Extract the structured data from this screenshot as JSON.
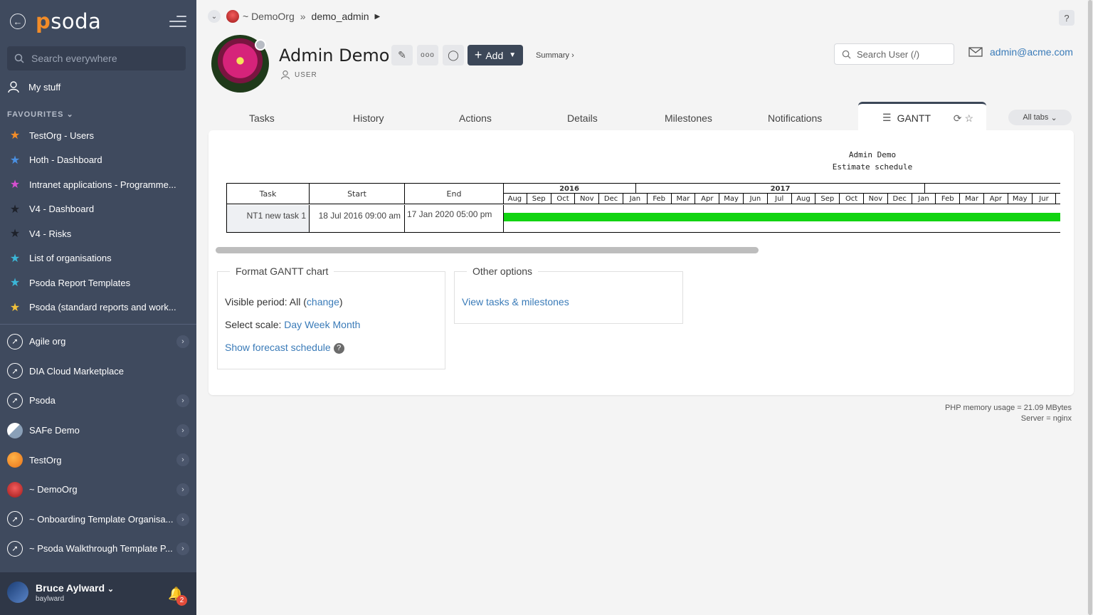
{
  "sidebar": {
    "logo_text": "psoda",
    "search_placeholder": "Search everywhere",
    "my_stuff": "My stuff",
    "favourites_heading": "FAVOURITES",
    "favourites": [
      {
        "label": "TestOrg - Users",
        "star_color": "#f28c28"
      },
      {
        "label": "Hoth - Dashboard",
        "star_color": "#4a90e2"
      },
      {
        "label": "Intranet applications - Programme...",
        "star_color": "#d64fd0"
      },
      {
        "label": "V4 - Dashboard",
        "star_color": "#2a2f3a"
      },
      {
        "label": "V4 - Risks",
        "star_color": "#2a2f3a"
      },
      {
        "label": "List of organisations",
        "star_color": "#3bb7d8"
      },
      {
        "label": "Psoda Report Templates",
        "star_color": "#3bb7d8"
      },
      {
        "label": "Psoda (standard reports and work...",
        "star_color": "#f2c23a"
      }
    ],
    "orgs": [
      {
        "label": "Agile org",
        "icon": "compass"
      },
      {
        "label": "DIA Cloud Marketplace",
        "icon": "compass"
      },
      {
        "label": "Psoda",
        "icon": "compass"
      },
      {
        "label": "SAFe Demo",
        "icon": "mountain"
      },
      {
        "label": "TestOrg",
        "icon": "orange-circle"
      },
      {
        "label": "~ DemoOrg",
        "icon": "red-flower"
      },
      {
        "label": "~ Onboarding Template Organisa...",
        "icon": "compass"
      },
      {
        "label": "~ Psoda Walkthrough Template P...",
        "icon": "compass"
      }
    ],
    "user": {
      "name": "Bruce Aylward",
      "login": "baylward",
      "notifications": "2"
    }
  },
  "breadcrumb": {
    "org": "~ DemoOrg",
    "separator": "»",
    "user": "demo_admin"
  },
  "header": {
    "title": "Admin Demo",
    "role": "USER",
    "add_label": "Add",
    "summary_link": "Summary ›",
    "search_placeholder": "Search User (/)",
    "email": "admin@acme.com",
    "help": "?"
  },
  "tabs": {
    "items": [
      "Tasks",
      "History",
      "Actions",
      "Details",
      "Milestones",
      "Notifications"
    ],
    "active": "GANTT",
    "all_tabs": "All tabs"
  },
  "gantt": {
    "title_line1": "Admin Demo",
    "title_line2": "Estimate schedule",
    "columns": [
      "Task",
      "Start",
      "End"
    ],
    "row": {
      "task": "NT1 new task 1",
      "start": "18 Jul 2016 09:00 am",
      "end": "17 Jan 2020 05:00 pm"
    },
    "years": [
      "2016",
      "2017"
    ],
    "months_2016": [
      "Aug",
      "Sep",
      "Oct",
      "Nov",
      "Dec"
    ],
    "months_2017": [
      "Jan",
      "Feb",
      "Mar",
      "Apr",
      "May",
      "Jun",
      "Jul",
      "Aug",
      "Sep",
      "Oct",
      "Nov",
      "Dec"
    ],
    "months_2018": [
      "Jan",
      "Feb",
      "Mar",
      "Apr",
      "May",
      "Jur"
    ],
    "bar_color": "#11d411"
  },
  "format_panel": {
    "legend": "Format GANTT chart",
    "visible_period_label": "Visible period: All (",
    "visible_period_link": "change",
    "visible_period_close": ")",
    "scale_label": "Select scale: ",
    "scale_day": "Day",
    "scale_week": "Week",
    "scale_month": "Month",
    "forecast_link": "Show forecast schedule"
  },
  "other_panel": {
    "legend": "Other options",
    "link": "View tasks & milestones"
  },
  "footer": {
    "memory": "PHP memory usage = 21.09 MBytes",
    "server": "Server = nginx"
  }
}
